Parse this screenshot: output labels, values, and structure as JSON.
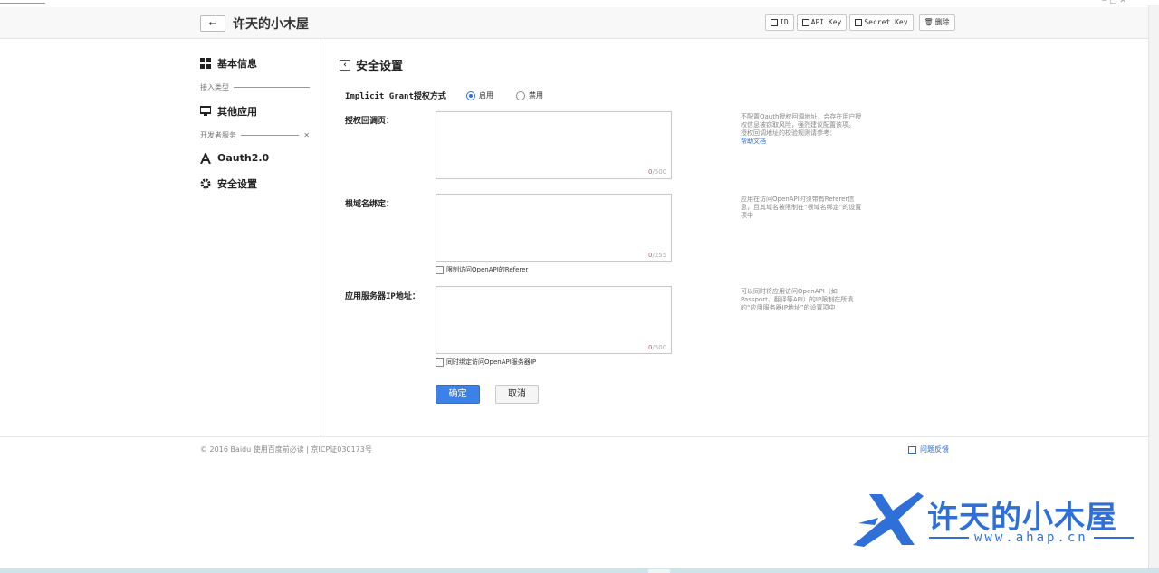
{
  "header": {
    "back_label": "⮠",
    "app_title": "许天的小木屋",
    "buttons": [
      "ID",
      "API Key",
      "Secret Key"
    ],
    "delete_label": "删除"
  },
  "sidebar": {
    "basic_info": "基本信息",
    "group_access": "接入类型",
    "other_apps": "其他应用",
    "group_dev": "开发者服务",
    "oauth": "Oauth2.0",
    "security": "安全设置"
  },
  "main": {
    "title": "安全设置",
    "implicit": {
      "label": "Implicit Grant授权方式",
      "enable": "启用",
      "disable": "禁用",
      "selected": "启用"
    },
    "callback": {
      "label": "授权回调页：",
      "count": "0",
      "max": "/500",
      "hint": "不配置Oauth授权回调地址，会存在用户授权信息被窃取风险，强烈建议配置该项。",
      "hint2": "授权回调地址的校验规则请参考：",
      "link": "帮助文档"
    },
    "domain": {
      "label": "根域名绑定：",
      "count": "0",
      "max": "/255",
      "check": "限制访问OpenAPI的Referer",
      "hint": "应用在访问OpenAPI时须带有Referer信息，且其域名被限制在“根域名绑定”的设置项中"
    },
    "server_ip": {
      "label": "应用服务器IP地址：",
      "count": "0",
      "max": "/500",
      "check": "同时绑定访问OpenAPI服务器IP",
      "hint": "可以同时将应用访问OpenAPI（如Passport、翻译等API）的IP限制在所填的“应用服务器IP地址”的设置项中"
    },
    "ok_label": "确定",
    "cancel_label": "取消"
  },
  "footer": {
    "copyright": "© 2016 Baidu 使用百度前必读 | 京ICP证030173号",
    "feedback": "问题反馈"
  },
  "watermark": {
    "title": "许天的小木屋",
    "url": "www.ahap.cn"
  },
  "colors": {
    "accent": "#3b82e8",
    "link": "#2e6bc9"
  }
}
